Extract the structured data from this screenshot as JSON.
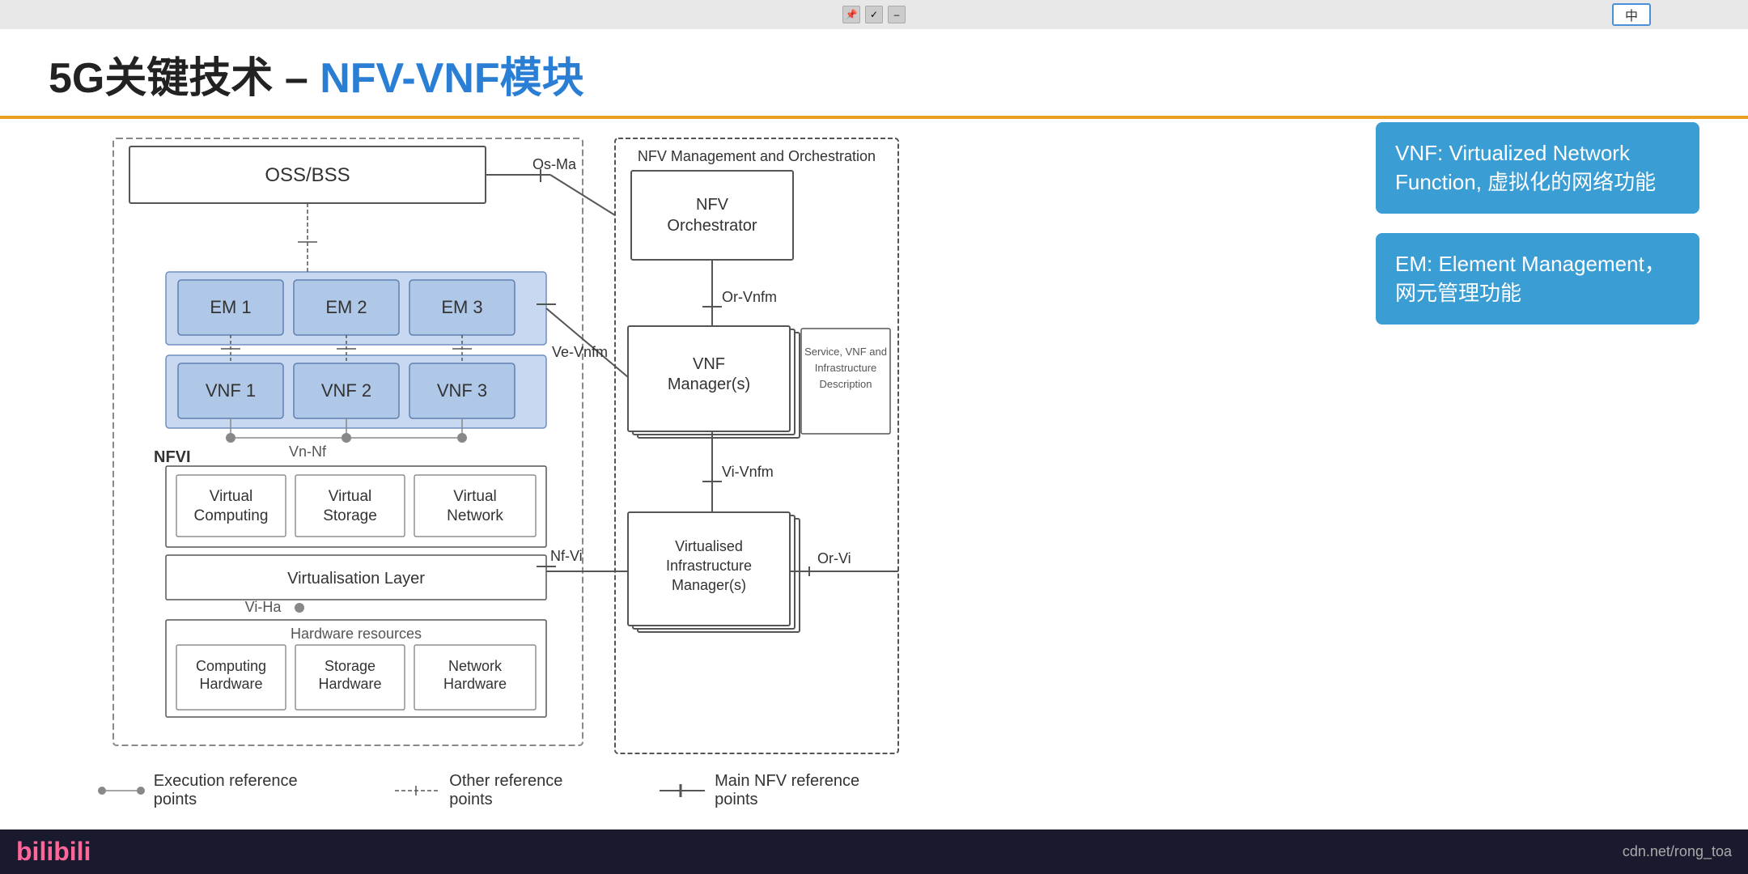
{
  "topbar": {
    "lang_label": "中"
  },
  "title": {
    "prefix": "5G关键技术 – ",
    "highlight": "NFV-VNF模块"
  },
  "info_boxes": [
    {
      "id": "vnf-box",
      "text": "VNF: Virtualized Network Function, 虚拟化的网络功能"
    },
    {
      "id": "em-box",
      "text": "EM: Element Management，网元管理功能"
    }
  ],
  "diagram": {
    "oss_bss": "OSS/BSS",
    "nfv_orchestration_label": "NFV Management and Orchestration",
    "nfv_orchestrator": "NFV Orchestrator",
    "vnf_manager": "VNF Manager(s)",
    "vim": "Virtualised Infrastructure Manager(s)",
    "service_desc": "Service, VNF and Infrastructure Description",
    "em_items": [
      "EM 1",
      "EM 2",
      "EM 3"
    ],
    "vnf_items": [
      "VNF 1",
      "VNF 2",
      "VNF 3"
    ],
    "nfvi_label": "NFVI",
    "virtual_computing": "Virtual Computing",
    "virtual_storage": "Virtual Storage",
    "virtual_network": "Virtual Network",
    "virtualisation_layer": "Virtualisation Layer",
    "hardware_resources": "Hardware resources",
    "computing_hardware": "Computing Hardware",
    "storage_hardware": "Storage Hardware",
    "network_hardware": "Network Hardware",
    "ref_os_ma": "Os-Ma",
    "ref_or_vnfm": "Or-Vnfm",
    "ref_ve_vnfm": "Ve-Vnfm",
    "ref_vi_vnfm": "Vi-Vnfm",
    "ref_nf_vi": "Nf-Vi",
    "ref_or_vi": "Or-Vi",
    "ref_vn_nf": "Vn-Nf",
    "ref_vi_ha": "Vi-Ha"
  },
  "legend": {
    "exec_ref": "Execution reference points",
    "other_ref": "Other reference points",
    "main_nfv": "Main NFV reference points"
  },
  "bottom": {
    "logo": "bilibili",
    "url": "cdn.net/rong_toa"
  }
}
